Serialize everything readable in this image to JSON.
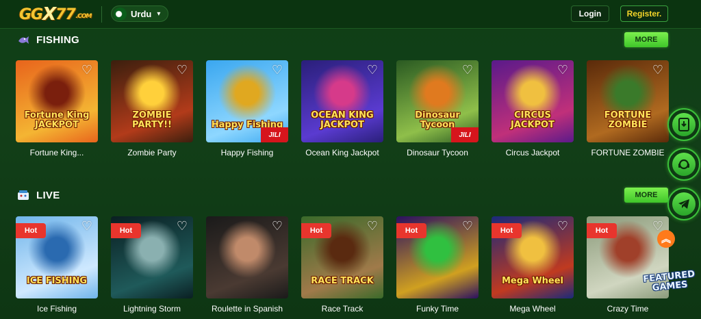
{
  "header": {
    "logo_main": "GG",
    "logo_x": "X",
    "logo_num": "77",
    "logo_com": ".COM",
    "language": "Urdu",
    "login_label": "Login",
    "register_label": "Register."
  },
  "sections": [
    {
      "title": "FISHING",
      "icon": "fishing-icon",
      "more_label": "MORE",
      "games": [
        {
          "name": "Fortune King...",
          "art_title": "Fortune King JACKPOT",
          "hot": false,
          "jili": false,
          "colors": [
            "#e8641c",
            "#f4b533",
            "#7a1f0d"
          ]
        },
        {
          "name": "Zombie Party",
          "art_title": "ZOMBIE PARTY!!",
          "hot": false,
          "jili": false,
          "colors": [
            "#3b1f0e",
            "#b23b1a",
            "#ffd03b"
          ]
        },
        {
          "name": "Happy Fishing",
          "art_title": "Happy Fishing",
          "hot": false,
          "jili": true,
          "colors": [
            "#3aa7f0",
            "#8ed7ff",
            "#e0a820"
          ]
        },
        {
          "name": "Ocean King Jackpot",
          "art_title": "OCEAN KING JACKPOT",
          "hot": false,
          "jili": false,
          "colors": [
            "#2a1f7a",
            "#5a3bd0",
            "#d63a8a"
          ]
        },
        {
          "name": "Dinosaur Tycoon",
          "art_title": "Dinosaur Tycoon",
          "hot": false,
          "jili": true,
          "colors": [
            "#2a5a22",
            "#8fbf4a",
            "#e07a1f"
          ]
        },
        {
          "name": "Circus Jackpot",
          "art_title": "CIRCUS JACKPOT",
          "hot": false,
          "jili": false,
          "colors": [
            "#5a1a8a",
            "#c0307a",
            "#f0c040"
          ]
        },
        {
          "name": "FORTUNE ZOMBIE",
          "art_title": "FORTUNE ZOMBIE",
          "hot": false,
          "jili": false,
          "colors": [
            "#5a2a0a",
            "#b06a20",
            "#3a7a2a"
          ]
        }
      ]
    },
    {
      "title": "LIVE",
      "icon": "live-icon",
      "more_label": "MORE",
      "games": [
        {
          "name": "Ice Fishing",
          "art_title": "ICE FISHING",
          "hot": true,
          "jili": false,
          "colors": [
            "#6fb4ea",
            "#cfe9ff",
            "#2a6ab0"
          ]
        },
        {
          "name": "Lightning Storm",
          "art_title": "",
          "hot": true,
          "jili": false,
          "colors": [
            "#0a1f22",
            "#1f5a5a",
            "#8ab0b0"
          ]
        },
        {
          "name": "Roulette in Spanish",
          "art_title": "",
          "hot": false,
          "jili": false,
          "colors": [
            "#1a1a1a",
            "#4a3a32",
            "#c08a6a"
          ]
        },
        {
          "name": "Race Track",
          "art_title": "RACE TRACK",
          "hot": true,
          "jili": false,
          "colors": [
            "#3a6a2a",
            "#a07a4a",
            "#5a2a10"
          ]
        },
        {
          "name": "Funky Time",
          "art_title": "",
          "hot": true,
          "jili": false,
          "colors": [
            "#2a1060",
            "#d0a020",
            "#30c040"
          ]
        },
        {
          "name": "Mega Wheel",
          "art_title": "Mega Wheel",
          "hot": true,
          "jili": false,
          "colors": [
            "#1a2a7a",
            "#c03a20",
            "#f0c040"
          ]
        },
        {
          "name": "Crazy Time",
          "art_title": "",
          "hot": true,
          "jili": false,
          "colors": [
            "#8a9a7a",
            "#d0d6c0",
            "#a0402a"
          ]
        }
      ]
    }
  ],
  "floating": {
    "download_icon": "download-icon",
    "support_icon": "support-icon",
    "telegram_icon": "telegram-icon",
    "featured_label": "FEATURED GAMES"
  }
}
